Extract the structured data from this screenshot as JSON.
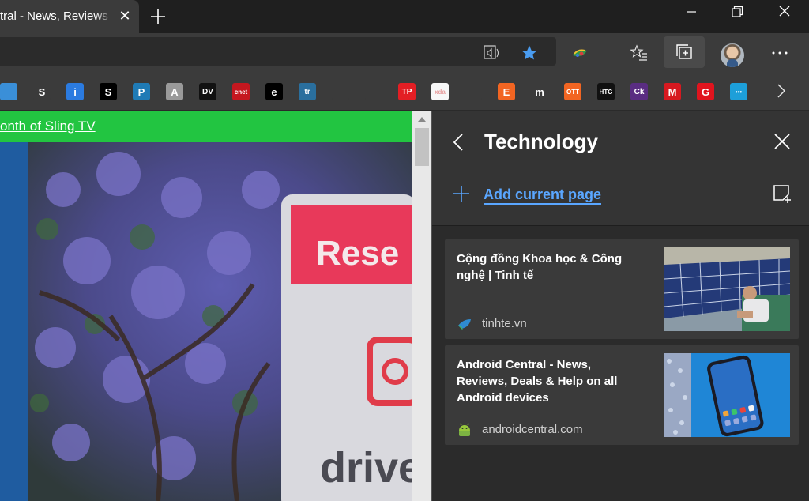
{
  "tab": {
    "title": "tral - News, Reviews",
    "close_glyph": "✕"
  },
  "window_controls": [
    "minimize-icon",
    "restore-icon",
    "close-icon"
  ],
  "toolbar": {
    "icons": [
      "read-aloud-icon",
      "favorite-star-icon",
      "color-extension-icon",
      "favorites-list-icon",
      "collections-icon",
      "profile-avatar",
      "more-menu-icon"
    ]
  },
  "favorites_bar": {
    "items": [
      {
        "name": "fav-tab-blue",
        "label": "",
        "color": "#3a8fd8"
      },
      {
        "name": "fav-s-white",
        "label": "S",
        "color": "#3b3b3b"
      },
      {
        "name": "fav-i-blue",
        "label": "i",
        "color": "#2b7be0"
      },
      {
        "name": "fav-s-black",
        "label": "S",
        "color": "#000000"
      },
      {
        "name": "fav-p-blue",
        "label": "P",
        "color": "#1f7bb6"
      },
      {
        "name": "fav-a-gray",
        "label": "A",
        "color": "#9a9a9a"
      },
      {
        "name": "fav-dv",
        "label": "DV",
        "color": "#111111"
      },
      {
        "name": "fav-cnet",
        "label": "cnet",
        "color": "#c5171f"
      },
      {
        "name": "fav-e",
        "label": "e",
        "color": "#000000"
      },
      {
        "name": "fav-tr",
        "label": "tr",
        "color": "#2a6f9e"
      },
      {
        "name": "fav-wave",
        "label": "",
        "color": "#3b3b3b"
      },
      {
        "name": "fav-drive",
        "label": "",
        "color": "#3b3b3b"
      },
      {
        "name": "fav-tp",
        "label": "TP",
        "color": "#e31e24"
      },
      {
        "name": "fav-xda",
        "label": "xda",
        "color": "#f7f7f7"
      },
      {
        "name": "fav-flower",
        "label": "",
        "color": "#3b3b3b"
      },
      {
        "name": "fav-e-orange",
        "label": "E",
        "color": "#f26522"
      },
      {
        "name": "fav-m",
        "label": "m",
        "color": "#3b3b3b"
      },
      {
        "name": "fav-ott",
        "label": "OTT",
        "color": "#f26522"
      },
      {
        "name": "fav-htg",
        "label": "HTG",
        "color": "#111111"
      },
      {
        "name": "fav-ck",
        "label": "Ck",
        "color": "#5a2d82"
      },
      {
        "name": "fav-m-red",
        "label": "M",
        "color": "#d71920"
      },
      {
        "name": "fav-g-red",
        "label": "G",
        "color": "#e0141e"
      },
      {
        "name": "fav-dots",
        "label": "•••",
        "color": "#1d9fd9"
      }
    ]
  },
  "page": {
    "promo_text": "onth of Sling TV",
    "sign_text_top": "Rese",
    "sign_text_bottom": "drive"
  },
  "collections": {
    "title": "Technology",
    "add_label": "Add current page",
    "items": [
      {
        "title": "Cộng đồng Khoa học & Công nghệ | Tinh tế",
        "domain": "tinhte.vn"
      },
      {
        "title": "Android Central - News, Reviews, Deals & Help on all Android devices",
        "domain": "androidcentral.com"
      }
    ]
  },
  "colors": {
    "accent_link": "#5aa6ff",
    "promo_green": "#22c541",
    "star_blue": "#4a9cf0"
  }
}
